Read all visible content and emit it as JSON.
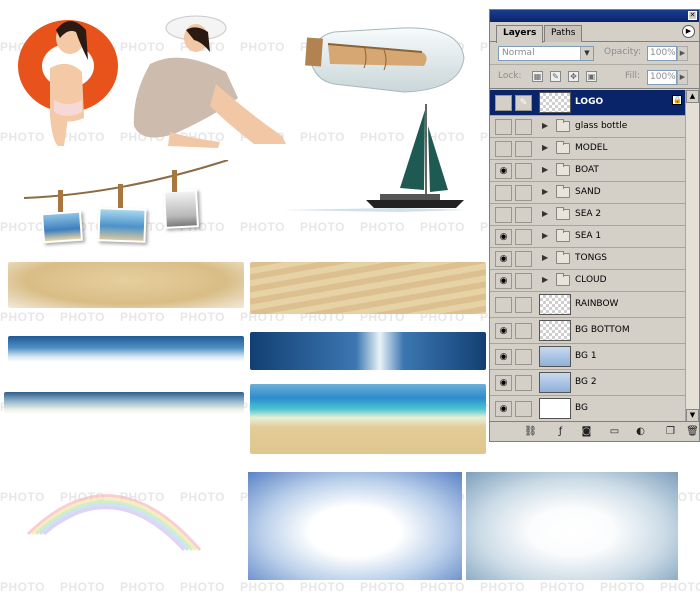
{
  "watermark": {
    "text": "PHOTO"
  },
  "layers_panel": {
    "tabs": [
      {
        "label": "Layers",
        "active": true
      },
      {
        "label": "Paths",
        "active": false
      }
    ],
    "blend_mode": "Normal",
    "opacity_label": "Opacity:",
    "opacity_value": "100%",
    "lock_label": "Lock:",
    "fill_label": "Fill:",
    "fill_value": "100%",
    "layers": [
      {
        "name": "LOGO",
        "type": "image",
        "visible": false,
        "selected": true,
        "locked": true
      },
      {
        "name": "glass bottle",
        "type": "group",
        "visible": false
      },
      {
        "name": "MODEL",
        "type": "group",
        "visible": false
      },
      {
        "name": "BOAT",
        "type": "group",
        "visible": true
      },
      {
        "name": "SAND",
        "type": "group",
        "visible": false
      },
      {
        "name": "SEA 2",
        "type": "group",
        "visible": false
      },
      {
        "name": "SEA 1",
        "type": "group",
        "visible": true
      },
      {
        "name": "TONGS",
        "type": "group",
        "visible": true
      },
      {
        "name": "CLOUD",
        "type": "group",
        "visible": true
      },
      {
        "name": "RAINBOW",
        "type": "image",
        "visible": false
      },
      {
        "name": "BG BOTTOM",
        "type": "image",
        "visible": true
      },
      {
        "name": "BG 1",
        "type": "image",
        "visible": true
      },
      {
        "name": "BG 2",
        "type": "image",
        "visible": true
      },
      {
        "name": "BG",
        "type": "image",
        "visible": true
      }
    ],
    "footer_icons": [
      "link-layers-icon",
      "add-style-icon",
      "add-mask-icon",
      "new-group-icon",
      "adjustment-layer-icon",
      "new-layer-icon",
      "trash-icon"
    ]
  },
  "colors": {
    "selection": "#0a246a",
    "panel_bg": "#d4d0c8",
    "float_ring": "#e8531c",
    "sail": "#1e5a52"
  }
}
